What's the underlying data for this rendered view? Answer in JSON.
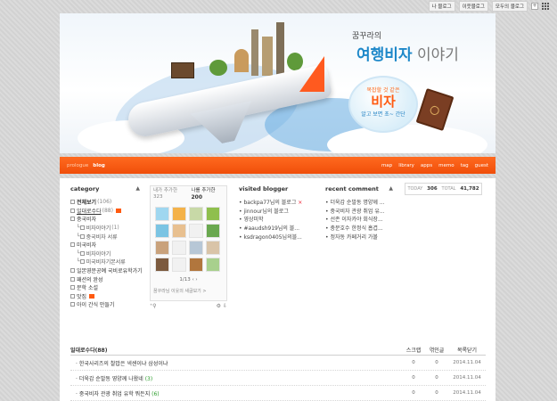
{
  "topbar": {
    "links": [
      "나 블로그",
      "이웃블로그",
      "모두의 블로그"
    ],
    "plus": "+"
  },
  "banner": {
    "subtitle": "꿈꾸라의",
    "title_bold": "여행비자",
    "title_light": " 이야기",
    "bubble_line1": "복잡할 것 같은",
    "bubble_line2": "비자",
    "bubble_line3": "알고 보면 초~ 간단"
  },
  "nav": {
    "left": [
      "prologue",
      "blog"
    ],
    "right": [
      "map",
      "library",
      "apps",
      "memo",
      "tag",
      "guest"
    ]
  },
  "category": {
    "title": "category",
    "items": [
      {
        "label": "전체보기",
        "count": "(106)",
        "level": 0,
        "bold": true
      },
      {
        "label": "일대로수다",
        "count": "(88)",
        "level": 0,
        "badge": true,
        "underline": true
      },
      {
        "label": "중국비자",
        "count": "",
        "level": 0
      },
      {
        "label": "비자이야기",
        "count": "(1)",
        "level": 1
      },
      {
        "label": "중국비자 서류",
        "count": "",
        "level": 1
      },
      {
        "label": "미국비자",
        "count": "",
        "level": 0
      },
      {
        "label": "비자이야기",
        "count": "",
        "level": 1
      },
      {
        "label": "미국비자기본서류",
        "count": "",
        "level": 1
      },
      {
        "label": "일본영문공예 국비로유학가기",
        "count": "",
        "level": 0
      },
      {
        "label": "패션의 완성",
        "count": "",
        "level": 0
      },
      {
        "label": "문학 소설",
        "count": "",
        "level": 0
      },
      {
        "label": "맛집",
        "count": "",
        "level": 0,
        "badge": true
      },
      {
        "label": "아이 간식 만들기",
        "count": "",
        "level": 0
      }
    ]
  },
  "neighbors": {
    "tab1_label": "내가 추가한",
    "tab1_count": "323",
    "tab2_label": "나를 추가한",
    "tab2_count": "200",
    "avatar_colors": [
      "#9fd7f0",
      "#f4b24a",
      "#c8d9a7",
      "#8fbf4d",
      "#7bc4e3",
      "#e8c090",
      "#f1f1f1",
      "#6aa84f",
      "#c9a27c",
      "#f1f1f1",
      "#b7c7d6",
      "#d9c4a8",
      "#7c5a3e",
      "#f1f1f1",
      "#b1763d",
      "#a8d08d"
    ],
    "pager": "1/13",
    "footer": "꿈꾸라님 이웃의 새글보기 >"
  },
  "visited": {
    "title": "visited blogger",
    "items": [
      "backpa77님의 블로그",
      "jinnour님의 블로그",
      "영상미학",
      "#aaudsh919님의 블...",
      "ksdragon0405님의블..."
    ]
  },
  "recent": {
    "title": "recent comment",
    "items": [
      "더욱갑 순발동 명양께 ...",
      "중국비자 관광 취업 유...",
      "선존 이자카야 회식장...",
      "충문호수 한정식 흡겹...",
      "정자동 카페거리 가볼"
    ]
  },
  "stats": {
    "today_label": "TODAY",
    "today": "306",
    "total_label": "TOTAL",
    "total": "41,782"
  },
  "list": {
    "title": "일대로수다(88)",
    "cols": [
      "스크랩",
      "엮인글",
      "목록닫기"
    ],
    "rows": [
      {
        "title": "한국사리즈의 찰밥은 넥센이냐 삼성이냐",
        "num": "",
        "scrap": "0",
        "link": "0",
        "date": "2014.11.04"
      },
      {
        "title": "더욱갑 순발동 영양께 나왔네",
        "num": "(3)",
        "scrap": "0",
        "link": "0",
        "date": "2014.11.04"
      },
      {
        "title": "중국비자 관광 취업 유학 뭐든지",
        "num": "(6)",
        "scrap": "0",
        "link": "0",
        "date": "2014.11.04"
      }
    ]
  }
}
